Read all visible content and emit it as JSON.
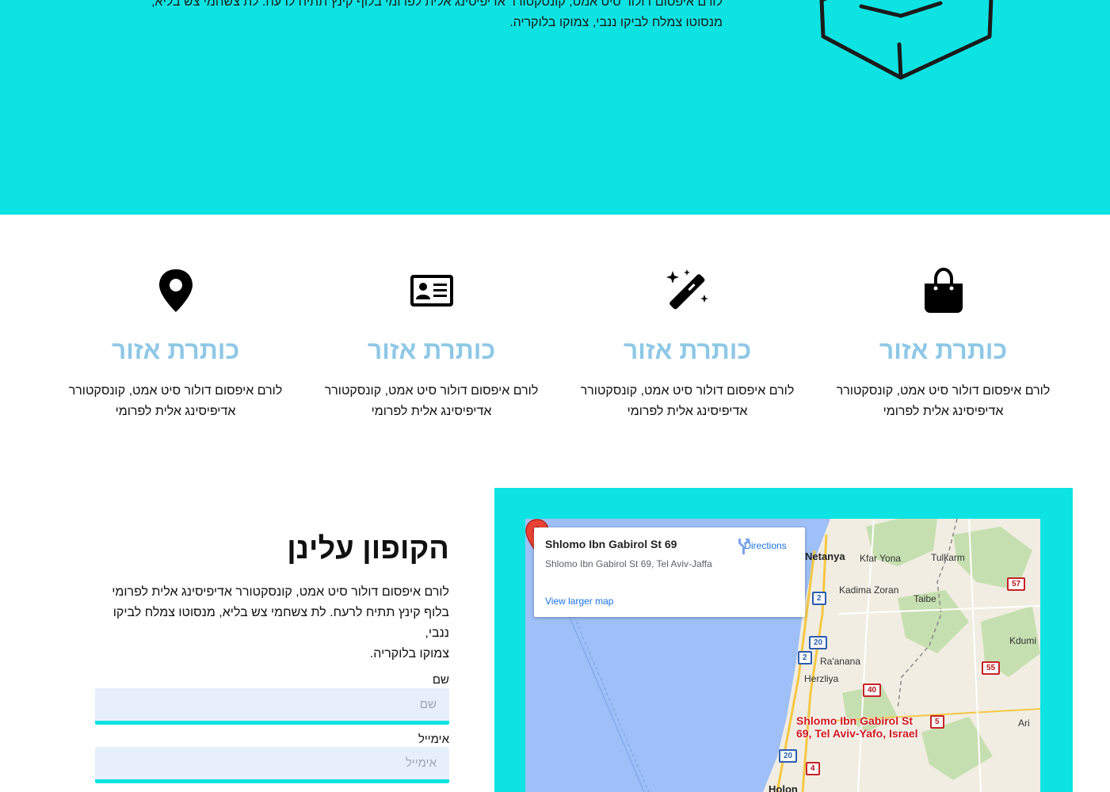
{
  "hero": {
    "line1": "לורם איפסום דולור סיט אמט, קונסקטורר אדיפיסינג אלית לפרומי בלוף קינץ תתיח לרעח. לת צשחמי צש בליא,",
    "line2": "מנסוטו צמלח לביקו ננבי, צמוקו בלוקריה.",
    "box_icon": "open-box-icon"
  },
  "features": [
    {
      "icon": "map-pin-icon",
      "title": "כותרת אזור",
      "line1": "לורם איפסום דולור סיט אמט, קונסקטורר",
      "line2": "אדיפיסינג אלית לפרומי"
    },
    {
      "icon": "id-card-icon",
      "title": "כותרת אזור",
      "line1": "לורם איפסום דולור סיט אמט, קונסקטורר",
      "line2": "אדיפיסינג אלית לפרומי"
    },
    {
      "icon": "magic-wand-icon",
      "title": "כותרת אזור",
      "line1": "לורם איפסום דולור סיט אמט, קונסקטורר",
      "line2": "אדיפיסינג אלית לפרומי"
    },
    {
      "icon": "shopping-bag-icon",
      "title": "כותרת אזור",
      "line1": "לורם איפסום דולור סיט אמט, קונסקטורר",
      "line2": "אדיפיסינג אלית לפרומי"
    }
  ],
  "coupon": {
    "title": "הקופון עלינן",
    "line1": "לורם איפסום דולור סיט אמט, קונסקטורר אדיפיסינג אלית לפרומי",
    "line2": "בלוף קינץ תתיח לרעח. לת צשחמי צש בליא, מנסוטו צמלח לביקו ננבי,",
    "line3": "צמוקו בלוקריה.",
    "name_label": "שם",
    "name_placeholder": "שם",
    "name_value": "",
    "email_label": "אימייל",
    "email_placeholder": "אימייל",
    "email_value": ""
  },
  "map": {
    "card_title": "Shlomo Ibn Gabirol St 69",
    "card_address": "Shlomo Ibn Gabirol St 69, Tel Aviv-Jaffa",
    "card_link": "View larger map",
    "directions_label": "Directions",
    "pin_label_line1": "Shlomo Ibn Gabirol St",
    "pin_label_line2": "69, Tel Aviv-Yafo, Israel",
    "places": {
      "netanya": "Netanya",
      "kfar_yona": "Kfar Yona",
      "tulkarm": "Tulkarm",
      "kadima_zoran": "Kadima Zoran",
      "taibe": "Taibe",
      "raanana": "Ra'anana",
      "herzliya": "Herzliya",
      "kdumim": "Kdumi",
      "ari": "Ari",
      "holon": "Holon"
    },
    "roads": {
      "r57": "57",
      "r2a": "2",
      "r20a": "20",
      "r2b": "2",
      "r55": "55",
      "r40": "40",
      "r5": "5",
      "r20b": "20",
      "r4": "4"
    },
    "colors": {
      "land": "#f1ede2",
      "sea": "#9ebff7",
      "green": "#c6dfb0",
      "pin": "#ea4335"
    }
  },
  "theme": {
    "accent": "#0ee3e3",
    "feature_title": "#8ec8e6",
    "input_bg": "#e7effc"
  }
}
